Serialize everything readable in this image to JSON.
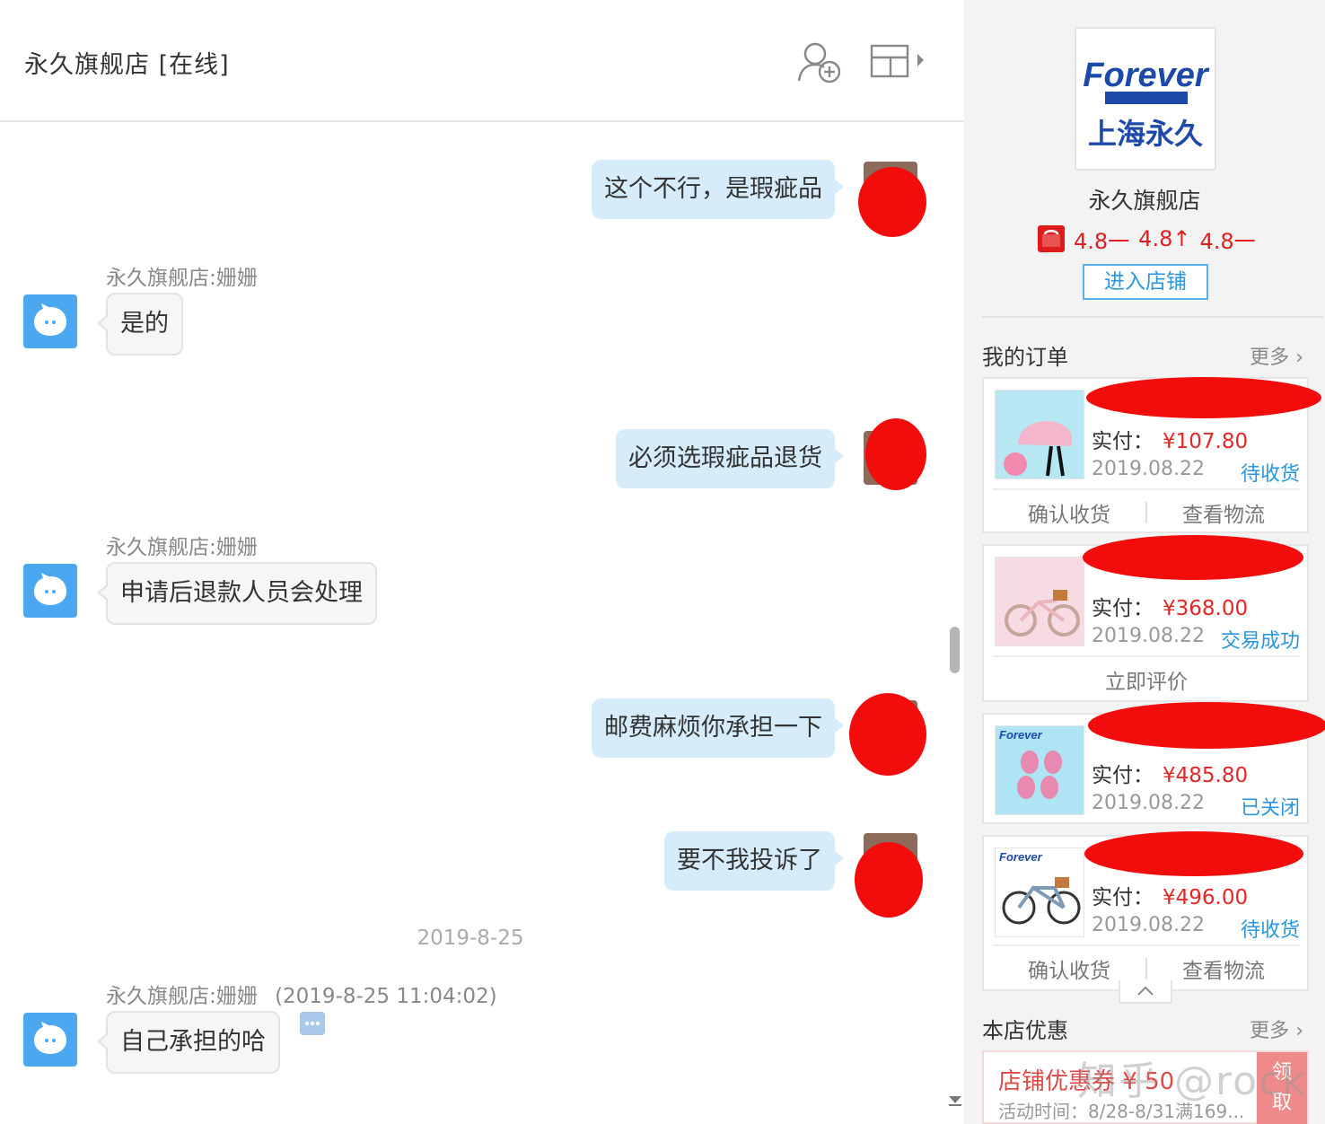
{
  "chat": {
    "title": "永久旗舰店 [在线]",
    "messages": [
      {
        "side": "right",
        "text": "这个不行，是瑕疵品"
      },
      {
        "side": "left",
        "sender": "永久旗舰店:姗姗",
        "text": "是的"
      },
      {
        "side": "right",
        "text": "必须选瑕疵品退货"
      },
      {
        "side": "left",
        "sender": "永久旗舰店:姗姗",
        "text": "申请后退款人员会处理"
      },
      {
        "side": "right",
        "text": "邮费麻烦你承担一下"
      },
      {
        "side": "right",
        "text": "要不我投诉了"
      },
      {
        "side": "left",
        "sender": "永久旗舰店:姗姗",
        "time": "(2019-8-25 11:04:02)",
        "text": "自己承担的哈"
      }
    ],
    "date_separator": "2019-8-25"
  },
  "side": {
    "logo": {
      "brand": "Forever",
      "cn": "上海永久"
    },
    "shop_name": "永久旗舰店",
    "ratings": [
      "4.8一",
      "4.8↑",
      "4.8一"
    ],
    "enter_shop": "进入店铺",
    "orders_title": "我的订单",
    "more": "更多",
    "orders": [
      {
        "pay_label": "实付：",
        "amount": "¥107.80",
        "date": "2019.08.22",
        "status": "待收货",
        "actions": [
          "确认收货",
          "查看物流"
        ]
      },
      {
        "pay_label": "实付：",
        "amount": "¥368.00",
        "date": "2019.08.22",
        "status": "交易成功",
        "actions": [
          "立即评价"
        ]
      },
      {
        "pay_label": "实付：",
        "amount": "¥485.80",
        "date": "2019.08.22",
        "status": "已关闭",
        "actions": []
      },
      {
        "pay_label": "实付：",
        "amount": "¥496.00",
        "date": "2019.08.22",
        "status": "待收货",
        "actions": [
          "确认收货",
          "查看物流"
        ]
      }
    ],
    "promo_title": "本店优惠",
    "coupon": {
      "title": "店铺优惠券 ¥ 50",
      "time": "活动时间：8/28-8/31满169...",
      "get": "领取"
    },
    "watermark": "知乎 @rock"
  },
  "colors": {
    "accent_blue": "#2a96dd",
    "price_red": "#e52626",
    "bubble_blue": "#d6ecfb",
    "redaction": "#f20c0c"
  }
}
